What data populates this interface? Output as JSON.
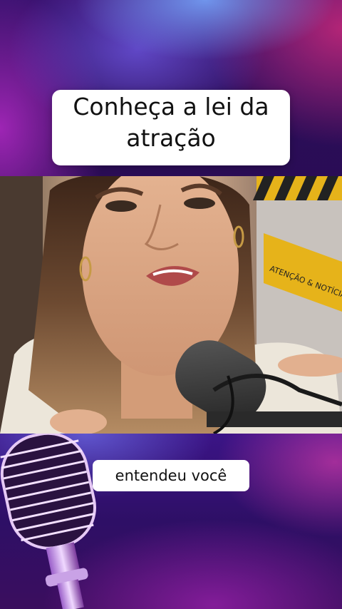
{
  "title": {
    "line1": "Conheça a lei da",
    "line2": "atração"
  },
  "subtitle": "entendeu você",
  "video": {
    "sign_text": "ATENÇÃO & NOTÍCIA"
  },
  "colors": {
    "background": "#2a0b3f",
    "text_box": "#ffffff",
    "text": "#111111",
    "caution_yellow": "#e6b31a"
  },
  "icons": {
    "microphone": "vintage-microphone-icon"
  }
}
